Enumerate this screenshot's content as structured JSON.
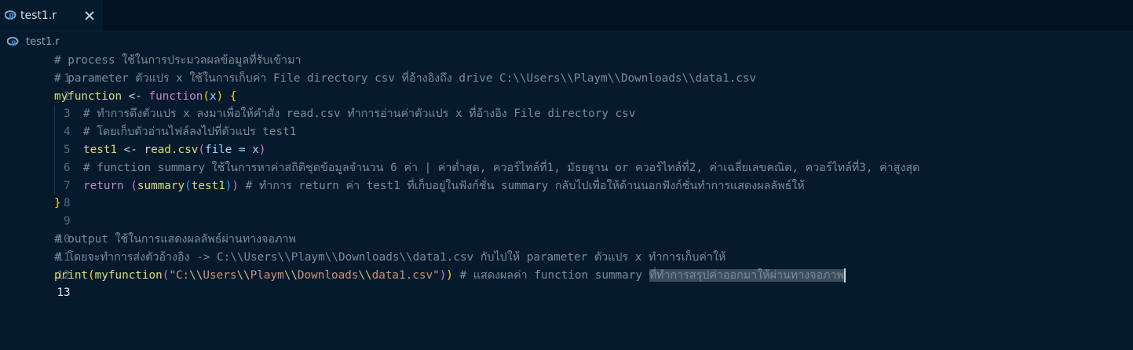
{
  "tab": {
    "title": "test1.r"
  },
  "breadcrumb": {
    "file": "test1.r"
  },
  "lines": {
    "l1": {
      "num": "1",
      "comment": "# process ใช้ในการประมวลผลข้อมูลที่รับเข้ามา"
    },
    "l2": {
      "num": "2",
      "comment": "# parameter ตัวแปร x ใช้ในการเก็บค่า File directory csv ที่อ้างอิงถึง drive C:\\\\Users\\\\Playm\\\\Downloads\\\\data1.csv"
    },
    "l3": {
      "num": "3",
      "name": "myfunction",
      "arrow": " <- ",
      "kw": "function",
      "open": "(",
      "param": "x",
      "close": ")",
      "brace": " {"
    },
    "l4": {
      "num": "4",
      "comment": "# ทำการดึงตัวแปร x ลงมาเพื่อให้คำสั่ง read.csv ทำการอ่านค่าตัวแปร x ที่อ้างอิง File directory csv"
    },
    "l5": {
      "num": "5",
      "comment": "# โดยเก็บตัวอ่านไฟล์ลงไปที่ตัวแปร test1"
    },
    "l6": {
      "num": "6",
      "var": "test1",
      "arrow": " <- ",
      "fn": "read.csv",
      "open": "(",
      "arg": "file = x",
      "close": ")"
    },
    "l7": {
      "num": "7",
      "comment": "# function summary ใช้ในการหาค่าสถิติชุดข้อมูลจำนวน 6 ค่า | ค่าต่ำสุด, ควอร์ไทล์ที่1, มัธยฐาน or ควอร์ไทล์ที่2, ค่าเฉลี่ยเลขคณิต, ควอร์ไทล์ที่3, ค่าสูงสุด"
    },
    "l8": {
      "num": "8",
      "kw": "return",
      "open1": " (",
      "fn": "summary",
      "open2": "(",
      "arg": "test1",
      "close2": ")",
      "close1": ")",
      "comment": " # ทำการ return ค่า test1 ที่เก็บอยู่ในฟังก์ชั่น summary กลับไปเพื่อให้ด้านนอกฟังก์ชั่นทำการแสดงผลลัพธ์ให้"
    },
    "l9": {
      "num": "9",
      "brace": "}"
    },
    "l10": {
      "num": "10"
    },
    "l11": {
      "num": "11",
      "comment": "# output ใช้ในการแสดงผลลัพธ์ผ่านทางจอภาพ"
    },
    "l12": {
      "num": "12",
      "comment": "# โดยจะทำการส่งตัวอ้างอิง -> C:\\\\Users\\\\Playm\\\\Downloads\\\\data1.csv กับไปให้ parameter ตัวแปร x ทำการเก็บค่าให้"
    },
    "l13": {
      "num": "13",
      "fn1": "print",
      "open1": "(",
      "fn2": "myfunction",
      "open2": "(",
      "str_a": "\"C:",
      "esc1": "\\\\",
      "str_b": "Users",
      "esc2": "\\\\",
      "str_c": "Playm",
      "esc3": "\\\\",
      "str_d": "Downloads",
      "esc4": "\\\\",
      "str_e": "data1.csv\"",
      "close2": ")",
      "close1": ")",
      "comment": " # แสดงผลค่า function summary ",
      "selected": "ที่ทำการสรุปค่าออกมาให้ผ่านทางจอภาพ"
    }
  }
}
